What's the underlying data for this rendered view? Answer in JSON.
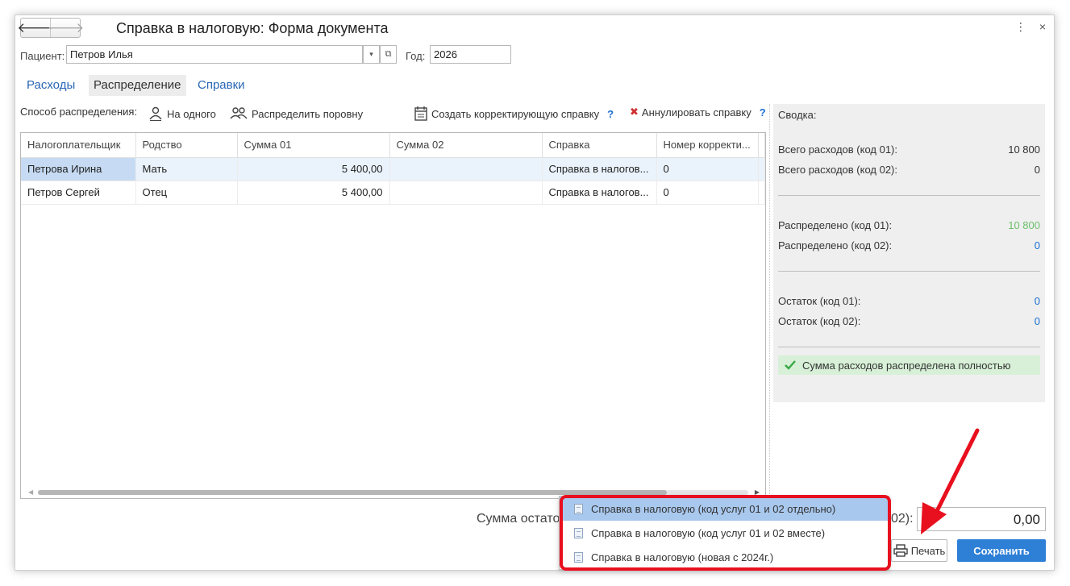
{
  "window": {
    "title": "Справка в налоговую: Форма документа",
    "more_icon": "⋮",
    "close_icon": "×"
  },
  "header": {
    "patient_label": "Пациент:",
    "patient_value": "Петров Илья",
    "year_label": "Год:",
    "year_value": "2026"
  },
  "tabs": [
    {
      "label": "Расходы",
      "active": false
    },
    {
      "label": "Распределение",
      "active": true
    },
    {
      "label": "Справки",
      "active": false
    }
  ],
  "toolbar": {
    "method_label": "Способ распределения:",
    "to_one": "На одного",
    "evenly": "Распределить поровну",
    "correction": "Создать корректирующую справку",
    "cancel": "Аннулировать справку",
    "help": "?"
  },
  "table": {
    "columns": [
      "Налогоплательщик",
      "Родство",
      "Сумма 01",
      "Сумма 02",
      "Справка",
      "Номер корректи..."
    ],
    "rows": [
      [
        "Петрова Ирина",
        "Мать",
        "5 400,00",
        "",
        "Справка в налогов...",
        "0"
      ],
      [
        "Петров Сергей",
        "Отец",
        "5 400,00",
        "",
        "Справка в налогов...",
        "0"
      ]
    ]
  },
  "summary": {
    "title": "Сводка:",
    "total01_label": "Всего расходов (код 01):",
    "total01_value": "10 800",
    "total02_label": "Всего расходов (код 02):",
    "total02_value": "0",
    "dist01_label": "Распределено (код 01):",
    "dist01_value": "10 800",
    "dist02_label": "Распределено (код 02):",
    "dist02_value": "0",
    "rest01_label": "Остаток (код 01):",
    "rest01_value": "0",
    "rest02_label": "Остаток (код 02):",
    "rest02_value": "0",
    "ok_message": "Сумма расходов распределена полностью"
  },
  "bottom": {
    "sum_label_visible": "Сумма остато",
    "sum_label_tail": "02):",
    "sum_value": "0,00",
    "print_label": "Печать",
    "save_label": "Сохранить"
  },
  "print_menu": [
    "Справка в налоговую (код услуг 01 и 02 отдельно)",
    "Справка в налоговую (код услуг 01 и 02 вместе)",
    "Справка в налоговую (новая с 2024г.)"
  ],
  "colors": {
    "accent": "#2e7fd6",
    "annotation": "#e8101e",
    "success_bg": "#d7f0d7",
    "green_value": "#6cbf6c",
    "blue_value": "#1a6fd1"
  }
}
